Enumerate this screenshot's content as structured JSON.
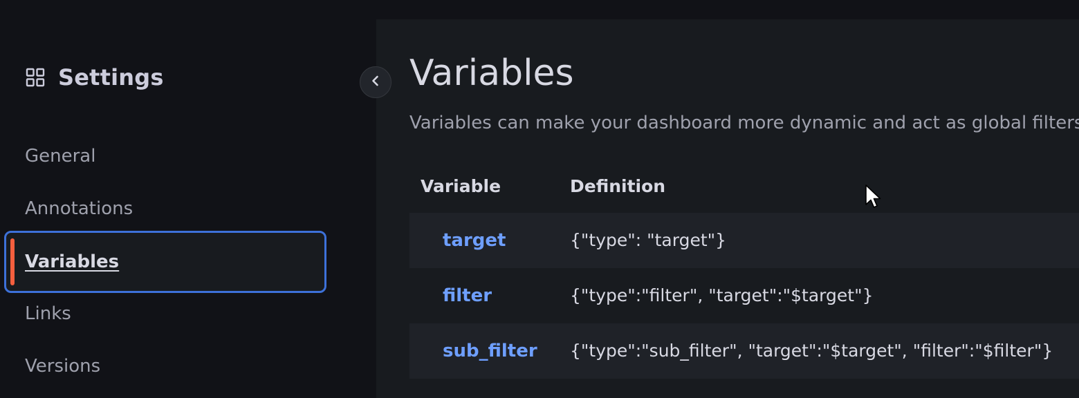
{
  "sidebar": {
    "title": "Settings",
    "title_icon": "dashboard-grid-icon",
    "items": [
      {
        "label": "General",
        "active": false
      },
      {
        "label": "Annotations",
        "active": false
      },
      {
        "label": "Variables",
        "active": true
      },
      {
        "label": "Links",
        "active": false
      },
      {
        "label": "Versions",
        "active": false
      }
    ],
    "active_accent_color": "#f55f3e",
    "active_border_color": "#3d71d9"
  },
  "collapse_button": {
    "icon": "chevron-left-icon"
  },
  "main": {
    "title": "Variables",
    "description": "Variables can make your dashboard more dynamic and act as global filters.",
    "table": {
      "columns": [
        "Variable",
        "Definition"
      ],
      "rows": [
        {
          "name": "target",
          "definition": "{\"type\": \"target\"}"
        },
        {
          "name": "filter",
          "definition": "{\"type\":\"filter\", \"target\":\"$target\"}"
        },
        {
          "name": "sub_filter",
          "definition": "{\"type\":\"sub_filter\", \"target\":\"$target\", \"filter\":\"$filter\"}"
        }
      ],
      "link_color": "#6e9fff"
    }
  }
}
